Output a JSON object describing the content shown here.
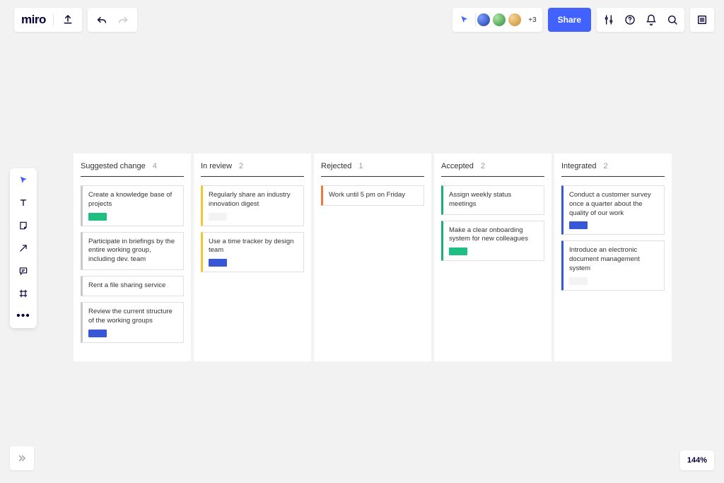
{
  "app": {
    "logo": "miro"
  },
  "header": {
    "more_avatars": "+3",
    "share_label": "Share"
  },
  "zoom": {
    "level": "144%"
  },
  "columns": [
    {
      "title": "Suggested change",
      "count": "4",
      "cards": [
        {
          "text": "Create a knowledge base of projects",
          "stripe": "c-gray",
          "swatch": "sw-green"
        },
        {
          "text": "Participate in briefings by the entire working group, including dev. team",
          "stripe": "c-gray",
          "swatch": ""
        },
        {
          "text": "Rent a file sharing service",
          "stripe": "c-gray",
          "swatch": ""
        },
        {
          "text": "Review the current structure of the working groups",
          "stripe": "c-gray",
          "swatch": "sw-blue"
        }
      ]
    },
    {
      "title": "In review",
      "count": "2",
      "cards": [
        {
          "text": "Regularly share an industry innovation digest",
          "stripe": "c-yellow",
          "swatch": "sw-light"
        },
        {
          "text": "Use a time tracker by design team",
          "stripe": "c-yellow",
          "swatch": "sw-blue"
        }
      ]
    },
    {
      "title": "Rejected",
      "count": "1",
      "cards": [
        {
          "text": "Work until 5 pm on Friday",
          "stripe": "c-orange",
          "swatch": ""
        }
      ]
    },
    {
      "title": "Accepted",
      "count": "2",
      "cards": [
        {
          "text": "Assign weekly status meetings",
          "stripe": "c-green",
          "swatch": ""
        },
        {
          "text": "Make a clear onboarding system for new colleagues",
          "stripe": "c-green",
          "swatch": "sw-green"
        }
      ]
    },
    {
      "title": "Integrated",
      "count": "2",
      "cards": [
        {
          "text": "Conduct a customer survey once a quarter about the quality of our work",
          "stripe": "c-blue",
          "swatch": "sw-blue"
        },
        {
          "text": "Introduce an electronic document management system",
          "stripe": "c-blue",
          "swatch": "sw-light"
        }
      ]
    }
  ]
}
